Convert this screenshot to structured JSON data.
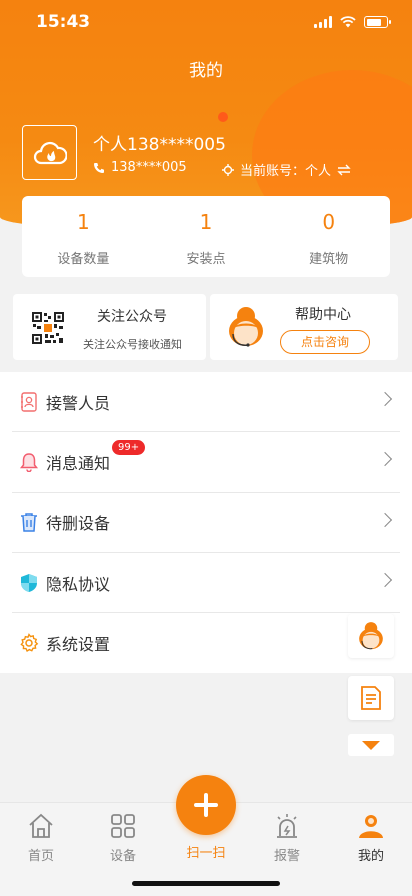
{
  "status_bar": {
    "time": "15:43"
  },
  "header": {
    "title": "我的"
  },
  "user": {
    "name": "个人138****005",
    "phone": "138****005",
    "account_label": "当前账号：个人"
  },
  "stats": [
    {
      "value": "1",
      "label": "设备数量"
    },
    {
      "value": "1",
      "label": "安装点"
    },
    {
      "value": "0",
      "label": "建筑物"
    }
  ],
  "cards": {
    "wechat": {
      "title": "关注公众号",
      "subtitle": "关注公众号接收通知"
    },
    "help": {
      "title": "帮助中心",
      "button": "点击咨询"
    }
  },
  "menu": [
    {
      "label": "接警人员",
      "icon": "contact-card-icon"
    },
    {
      "label": "消息通知",
      "icon": "bell-icon",
      "badge": "99+"
    },
    {
      "label": "待删设备",
      "icon": "trash-icon"
    },
    {
      "label": "隐私协议",
      "icon": "shield-icon"
    },
    {
      "label": "系统设置",
      "icon": "gear-icon"
    }
  ],
  "tabs": {
    "home": "首页",
    "devices": "设备",
    "scan": "扫一扫",
    "alarm": "报警",
    "mine": "我的"
  },
  "colors": {
    "accent": "#f5820f",
    "badge": "#ee2a2a"
  }
}
